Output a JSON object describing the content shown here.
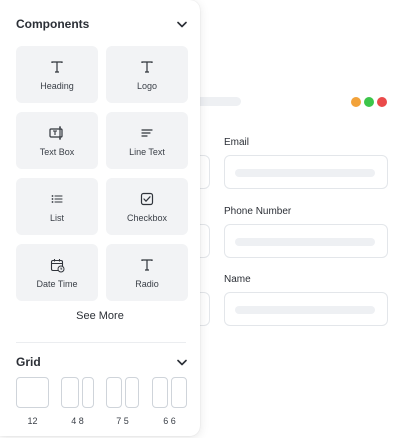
{
  "colors": {
    "traffic_orange": "#f2a23a",
    "traffic_green": "#3cc54a",
    "traffic_red": "#ea4a4a",
    "tile_bg": "#f2f3f5"
  },
  "components": {
    "title": "Components",
    "items": [
      {
        "label": "Heading",
        "icon": "heading-icon"
      },
      {
        "label": "Logo",
        "icon": "logo-icon"
      },
      {
        "label": "Text Box",
        "icon": "text-box-icon"
      },
      {
        "label": "Line Text",
        "icon": "line-text-icon"
      },
      {
        "label": "List",
        "icon": "list-icon"
      },
      {
        "label": "Checkbox",
        "icon": "checkbox-icon"
      },
      {
        "label": "Date Time",
        "icon": "calendar-icon"
      },
      {
        "label": "Radio",
        "icon": "radio-icon"
      }
    ],
    "see_more": "See More"
  },
  "grid": {
    "title": "Grid",
    "options": [
      {
        "label": "12"
      },
      {
        "label": "4 8"
      },
      {
        "label": "7 5"
      },
      {
        "label": "6 6"
      }
    ]
  },
  "form": {
    "fields": [
      {
        "label": "Email"
      },
      {
        "label": "Phone Number"
      },
      {
        "label": "Name"
      }
    ]
  }
}
